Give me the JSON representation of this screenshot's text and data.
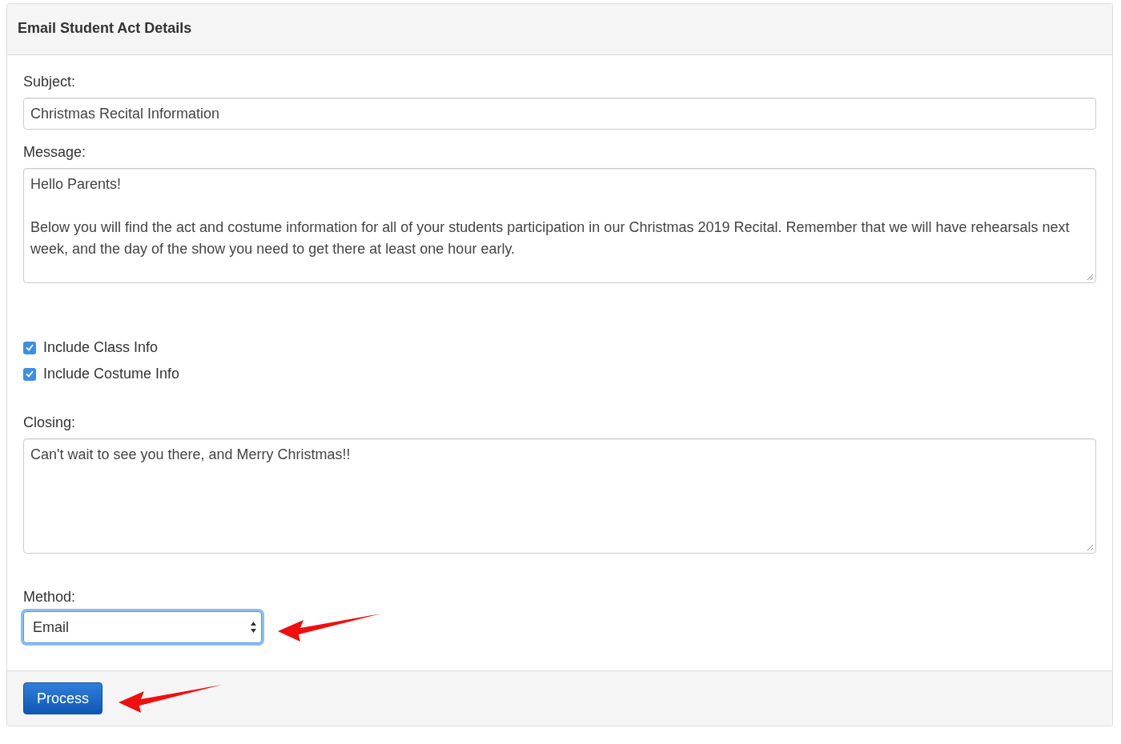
{
  "panel": {
    "title": "Email Student Act Details"
  },
  "fields": [
    {
      "kind": "input",
      "label": "Subject:",
      "value": "Christmas Recital Information"
    },
    {
      "kind": "textarea",
      "label": "Message:",
      "value": "Hello Parents!\n\nBelow you will find the act and costume information for all of your students participation in our Christmas 2019 Recital. Remember that we will have rehearsals next week, and the day of the show you need to get there at least one hour early."
    }
  ],
  "options": [
    {
      "label": "Include Class Info",
      "checked": true
    },
    {
      "label": "Include Costume Info",
      "checked": true
    }
  ],
  "closing": {
    "label": "Closing:",
    "value": "Can't wait to see you there, and Merry Christmas!!"
  },
  "method": {
    "label": "Method:",
    "value": "Email",
    "focused": true
  },
  "buttons": [
    "Process"
  ]
}
